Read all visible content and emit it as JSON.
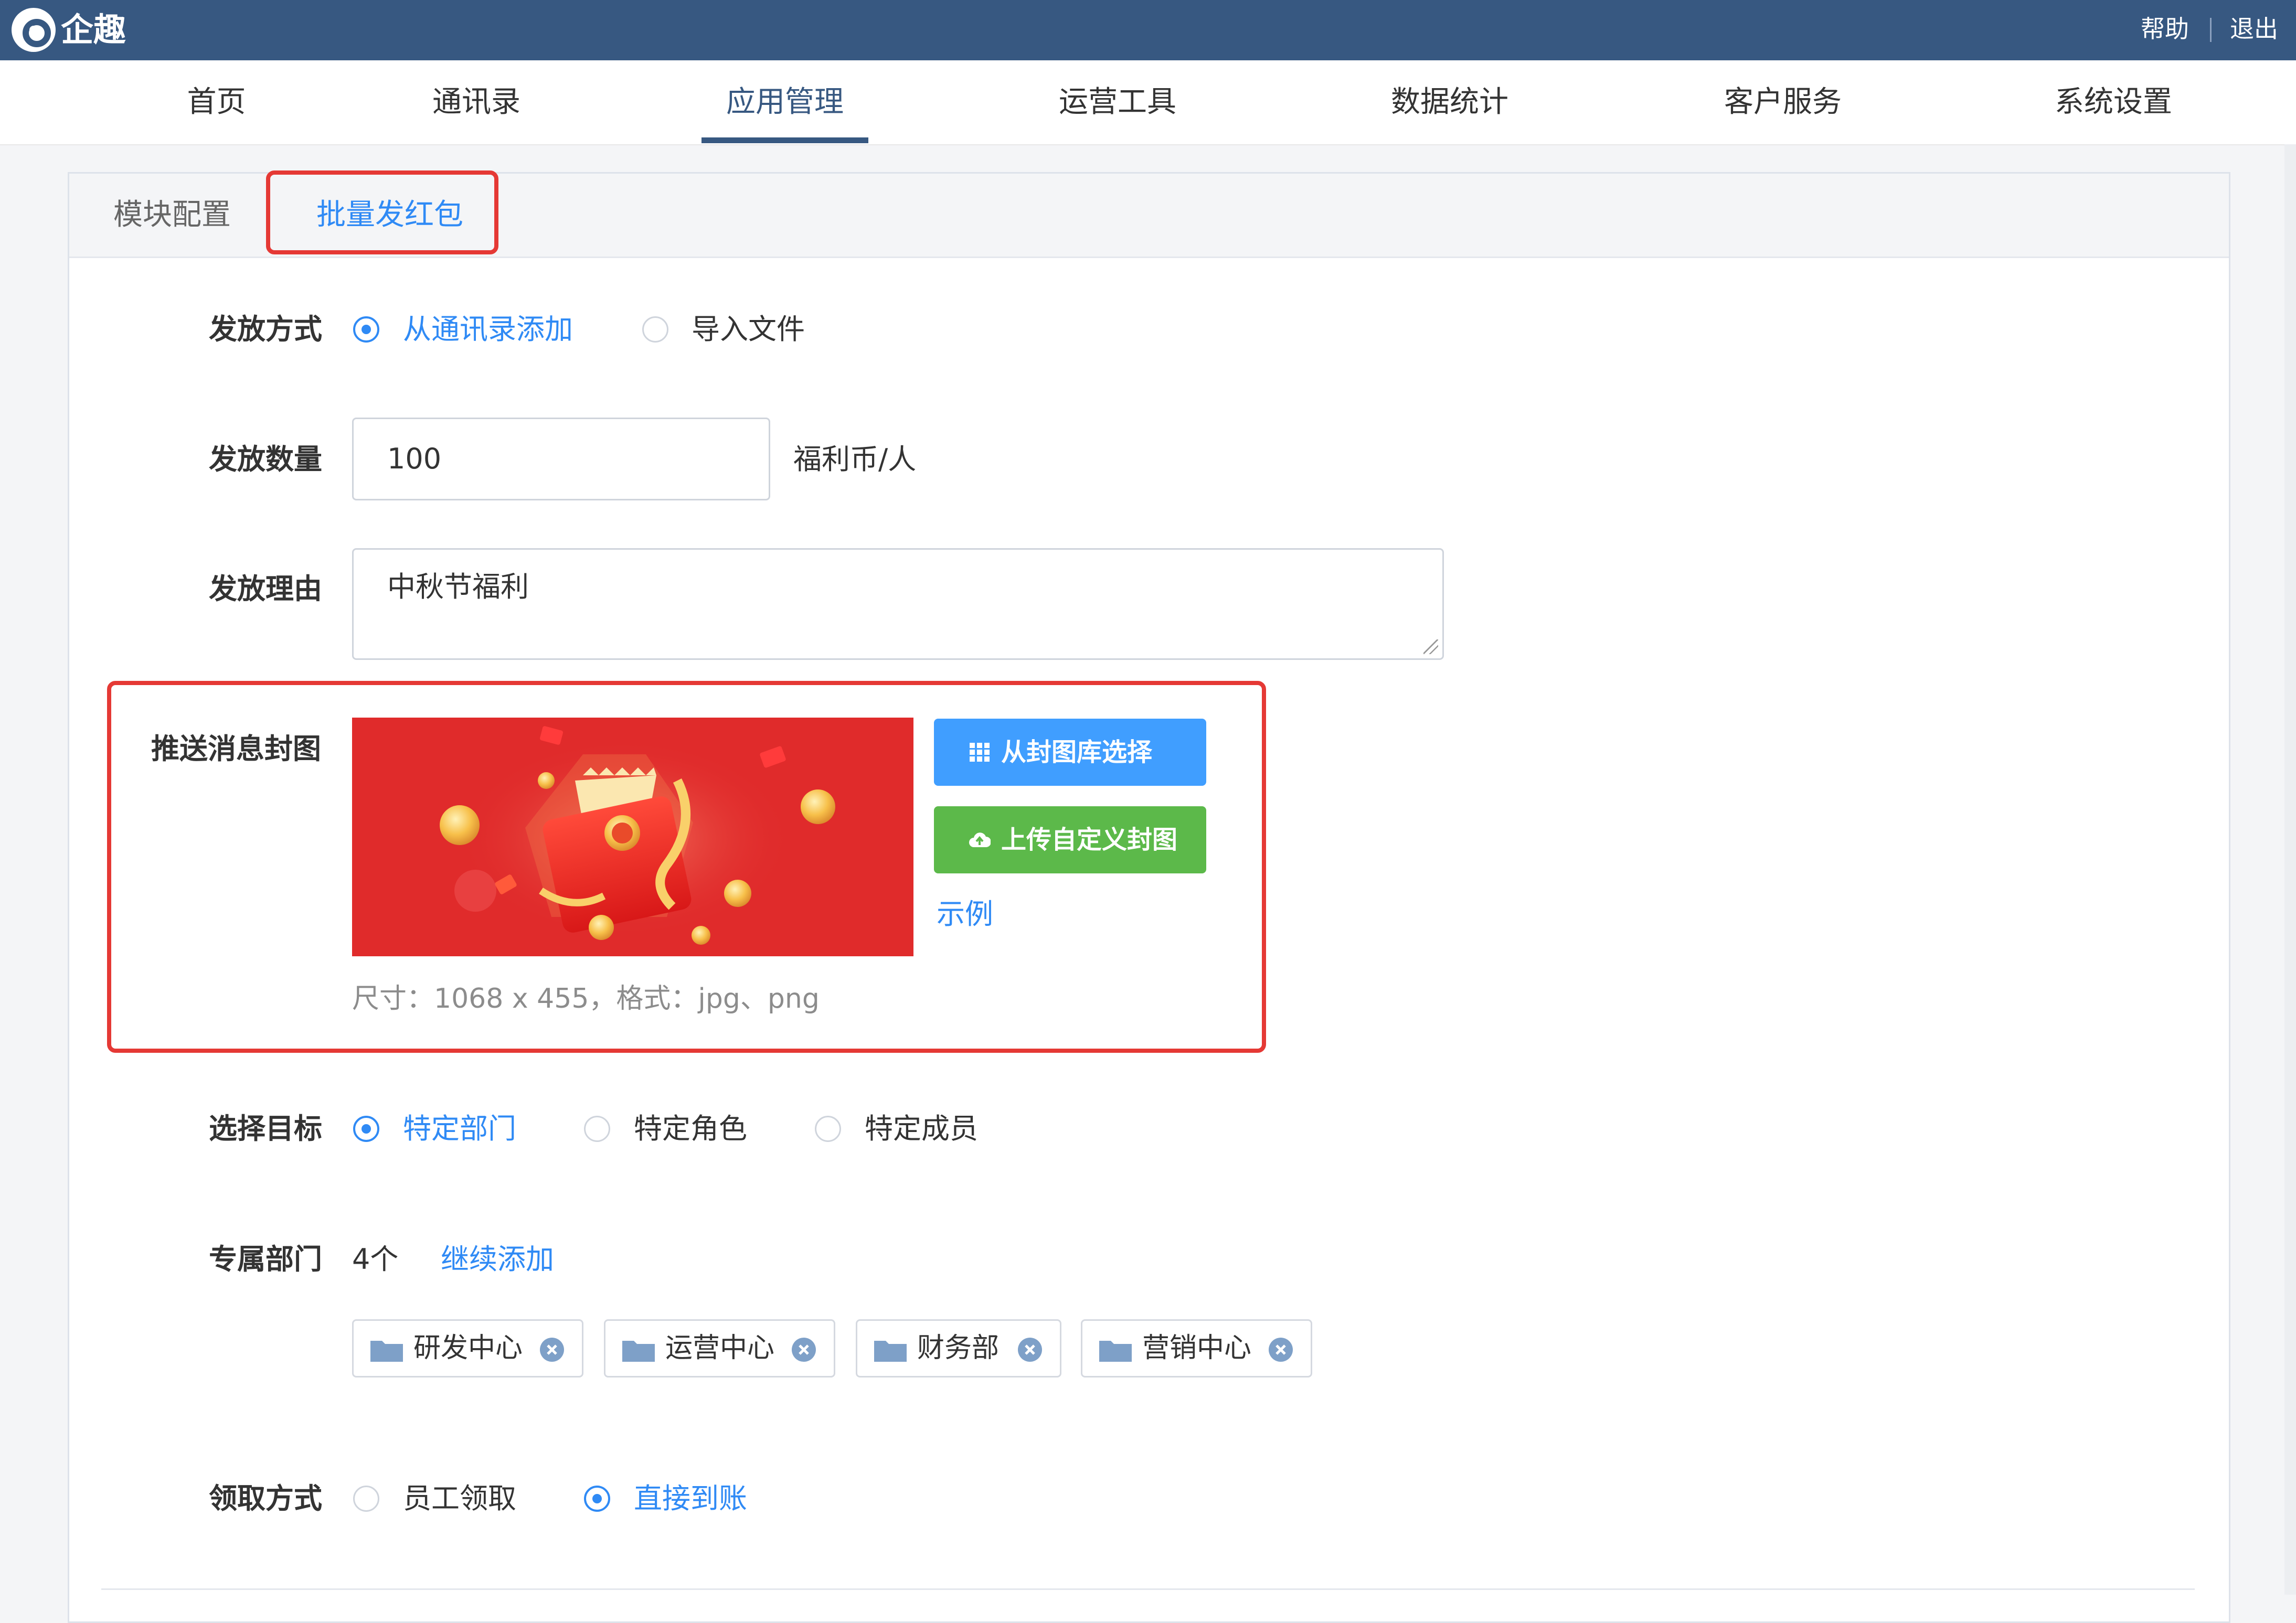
{
  "app": {
    "title": "企趣"
  },
  "topbar": {
    "help": "帮助",
    "logout": "退出"
  },
  "nav": [
    "首页",
    "通讯录",
    "应用管理",
    "运营工具",
    "数据统计",
    "客户服务",
    "系统设置"
  ],
  "nav_active": "应用管理",
  "tabs": {
    "module_config": "模块配置",
    "batch_red_packet": "批量发红包",
    "active": "批量发红包"
  },
  "form": {
    "method": {
      "label": "发放方式",
      "options": [
        "从通讯录添加",
        "导入文件"
      ],
      "selected": "从通讯录添加"
    },
    "quantity": {
      "label": "发放数量",
      "value": "100",
      "unit": "福利币/人"
    },
    "reason": {
      "label": "发放理由",
      "value": "中秋节福利"
    },
    "cover": {
      "label": "推送消息封图",
      "from_library": "从封图库选择",
      "upload_custom": "上传自定义封图",
      "example": "示例",
      "hint": "尺寸：1068 x 455，格式：jpg、png"
    },
    "target": {
      "label": "选择目标",
      "options": [
        "特定部门",
        "特定角色",
        "特定成员"
      ],
      "selected": "特定部门"
    },
    "departments": {
      "label": "专属部门",
      "count": "4个",
      "add_more": "继续添加",
      "items": [
        "研发中心",
        "运营中心",
        "财务部",
        "营销中心"
      ]
    },
    "receive": {
      "label": "领取方式",
      "options": [
        "员工领取",
        "直接到账"
      ],
      "selected": "直接到账"
    }
  },
  "colors": {
    "topbar": "#375881",
    "accent": "#2f8af5",
    "highlight": "#e53935",
    "success": "#5cb94a",
    "primary_button": "#409eff"
  }
}
